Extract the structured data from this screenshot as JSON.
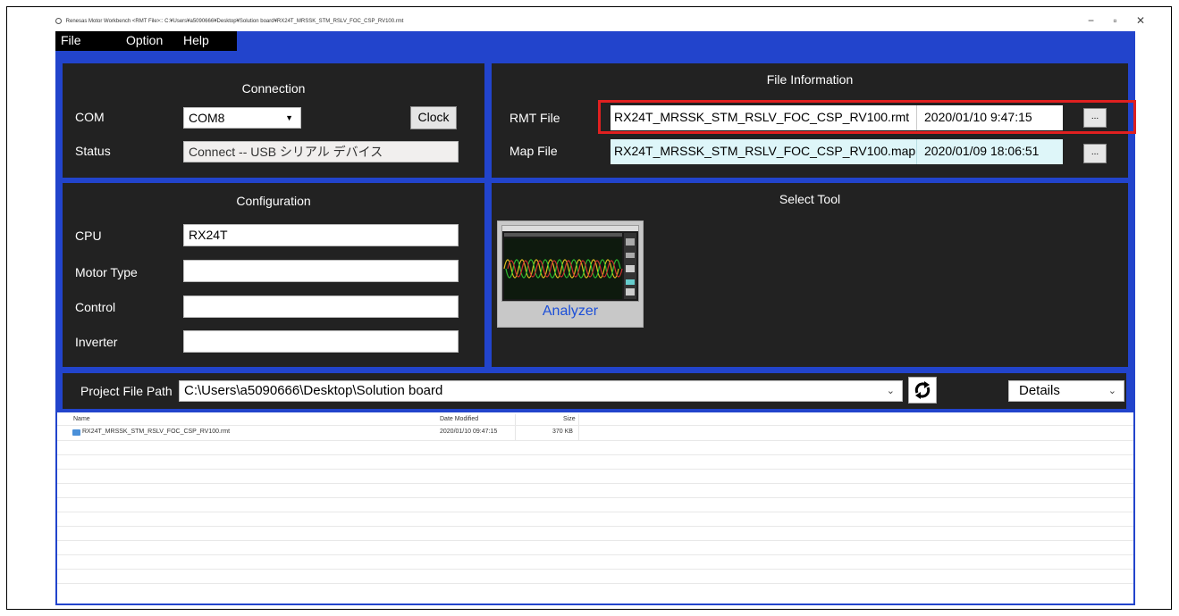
{
  "titlebar": {
    "text": "Renesas Motor Workbench    <RMT File>:: C:¥Users¥a5090666¥Desktop¥Solution board¥RX24T_MRSSK_STM_RSLV_FOC_CSP_RV100.rmt",
    "minimize": "−",
    "maximize": "▫",
    "close": "✕"
  },
  "menu": {
    "file": "File",
    "option": "Option",
    "help": "Help"
  },
  "connection": {
    "title": "Connection",
    "com_label": "COM",
    "com_value": "COM8",
    "clock_label": "Clock",
    "status_label": "Status",
    "status_value": "Connect -- USB シリアル デバイス"
  },
  "file_info": {
    "title": "File Information",
    "rmt_label": "RMT File",
    "rmt_value": "RX24T_MRSSK_STM_RSLV_FOC_CSP_RV100.rmt",
    "rmt_date": "2020/01/10 9:47:15",
    "map_label": "Map File",
    "map_value": "RX24T_MRSSK_STM_RSLV_FOC_CSP_RV100.map",
    "map_date": "2020/01/09 18:06:51",
    "browse_label": "..."
  },
  "configuration": {
    "title": "Configuration",
    "cpu_label": "CPU",
    "cpu_value": "RX24T",
    "motor_type_label": "Motor Type",
    "motor_type_value": "",
    "control_label": "Control",
    "control_value": "",
    "inverter_label": "Inverter",
    "inverter_value": ""
  },
  "select_tool": {
    "title": "Select Tool",
    "tool_label": "Analyzer"
  },
  "project": {
    "label": "Project File Path",
    "path": "C:\\Users\\a5090666\\Desktop\\Solution board",
    "view_mode": "Details"
  },
  "file_list": {
    "headers": {
      "name": "Name",
      "modified": "Date Modified",
      "size": "Size"
    },
    "rows": [
      {
        "name": "RX24T_MRSSK_STM_RSLV_FOC_CSP_RV100.rmt",
        "modified": "2020/01/10 09:47:15",
        "size": "370 KB"
      }
    ]
  },
  "colors": {
    "app_background": "#2244cc",
    "panel": "#222222",
    "highlight": "#e02020",
    "map_field": "#def6f9",
    "analyzer_text": "#1c4fd8"
  },
  "icons": {
    "refresh": "refresh-icon",
    "dropdown": "chevron-down-icon",
    "file": "file-icon"
  }
}
